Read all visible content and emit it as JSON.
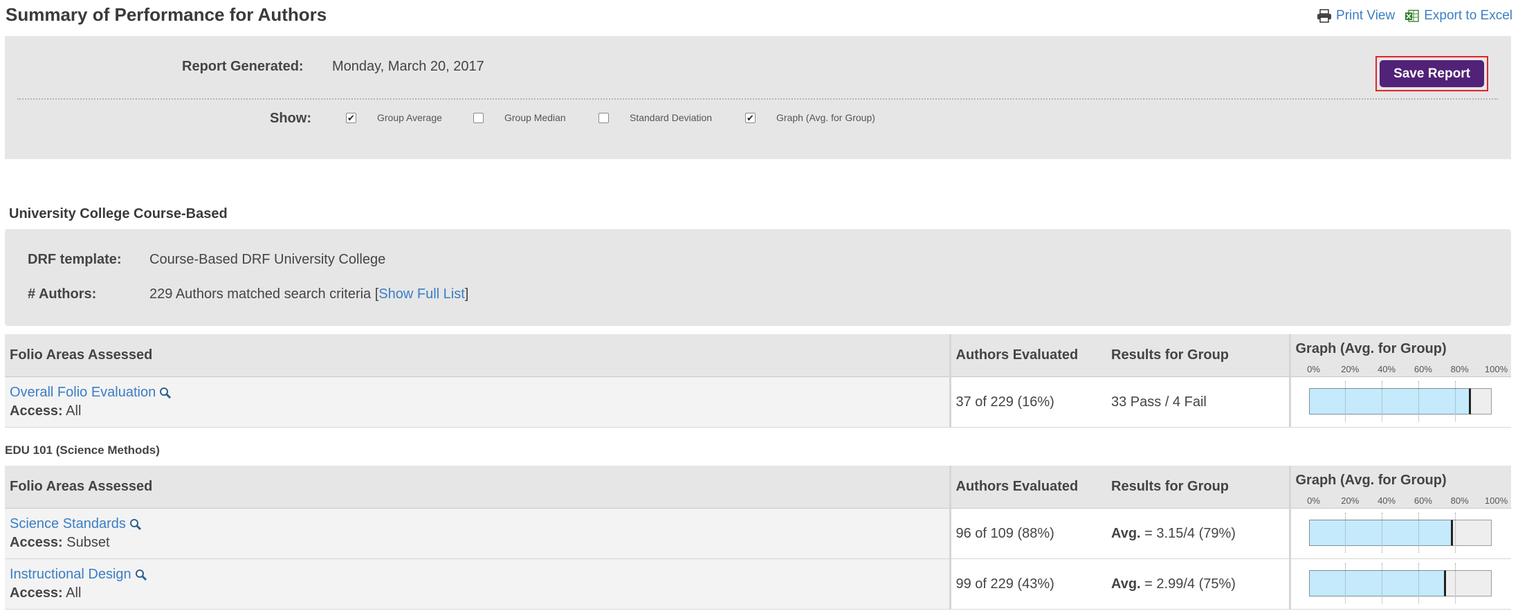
{
  "header": {
    "title": "Summary of Performance for Authors",
    "print_view": "Print View",
    "export_excel": "Export to Excel",
    "print_icon": "printer-icon",
    "excel_icon": "excel-icon"
  },
  "settings": {
    "report_generated_label": "Report Generated:",
    "report_generated_value": "Monday, March 20, 2017",
    "save_button": "Save Report",
    "show_label": "Show:",
    "options": [
      {
        "label": "Group Average",
        "checked": true
      },
      {
        "label": "Group Median",
        "checked": false
      },
      {
        "label": "Standard Deviation",
        "checked": false
      },
      {
        "label": "Graph (Avg. for Group)",
        "checked": true
      }
    ]
  },
  "group": {
    "title": "University College Course-Based",
    "drf_label": "DRF template:",
    "drf_value": "Course-Based DRF University College",
    "authors_label": "# Authors:",
    "authors_value": "229 Authors matched search criteria [",
    "show_full_list": "Show Full List",
    "authors_value_end": "]"
  },
  "columns": {
    "area": "Folio Areas Assessed",
    "evaluated": "Authors Evaluated",
    "results": "Results for Group",
    "graph": "Graph (Avg. for Group)",
    "scale": [
      "0%",
      "20%",
      "40%",
      "60%",
      "80%",
      "100%"
    ]
  },
  "table1": {
    "rows": [
      {
        "area": "Overall Folio Evaluation",
        "access_label": "Access:",
        "access": "All",
        "evaluated": "37 of 229  (16%)",
        "results_prefix": "",
        "results": "33 Pass / 4 Fail",
        "graph_pct": 89
      }
    ]
  },
  "subgroup": {
    "title": "EDU 101 (Science Methods)"
  },
  "table2": {
    "rows": [
      {
        "area": "Science Standards",
        "access_label": "Access:",
        "access": "Subset",
        "evaluated": "96 of 109  (88%)",
        "results_prefix": "Avg.",
        "results": " = 3.15/4 (79%)",
        "graph_pct": 79
      },
      {
        "area": "Instructional Design",
        "access_label": "Access:",
        "access": "All",
        "evaluated": "99 of 229  (43%)",
        "results_prefix": "Avg.",
        "results": " = 2.99/4 (75%)",
        "graph_pct": 75
      }
    ]
  },
  "colors": {
    "accent": "#512277",
    "link": "#3b7dc4",
    "bar_fill": "#c4eafc",
    "panel": "#e6e6e6",
    "highlight": "#e2232a"
  }
}
